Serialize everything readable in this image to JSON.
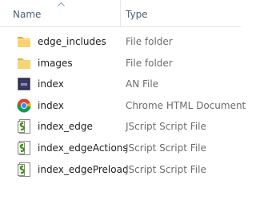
{
  "columns": {
    "name": "Name",
    "type": "Type",
    "sort": "ascending"
  },
  "files": [
    {
      "name": "edge_includes",
      "type": "File folder",
      "icon": "folder-icon"
    },
    {
      "name": "images",
      "type": "File folder",
      "icon": "folder-icon"
    },
    {
      "name": "index",
      "type": "AN File",
      "icon": "an-file-icon"
    },
    {
      "name": "index",
      "type": "Chrome HTML Document",
      "icon": "chrome-icon"
    },
    {
      "name": "index_edge",
      "type": "JScript Script File",
      "icon": "jscript-icon"
    },
    {
      "name": "index_edgeActions",
      "type": "JScript Script File",
      "icon": "jscript-icon"
    },
    {
      "name": "index_edgePreload",
      "type": "JScript Script File",
      "icon": "jscript-icon"
    }
  ],
  "colors": {
    "header_text": "#4c607a",
    "type_text": "#6d6d6d",
    "folder": "#f2c65a",
    "jscript_green": "#3e8a1e"
  }
}
